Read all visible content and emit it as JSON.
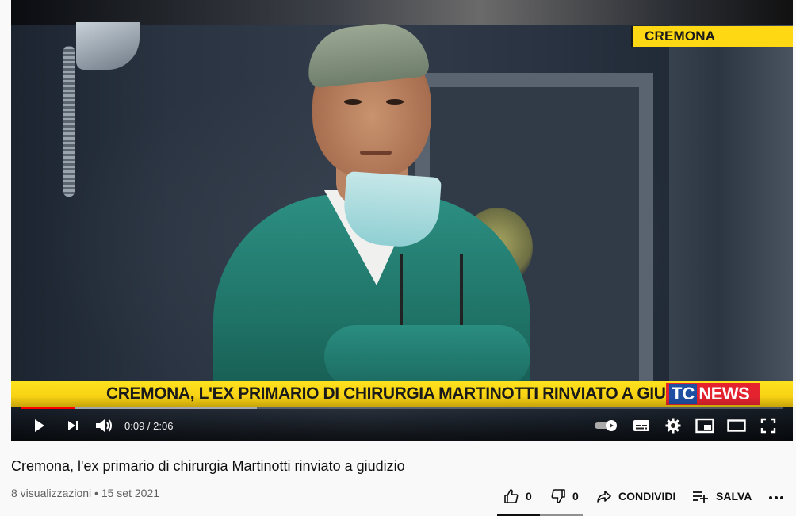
{
  "video": {
    "station_tag": "CREMONA",
    "lower_third": "CREMONA, L'EX PRIMARIO DI CHIRURGIA MARTINOTTI RINVIATO A GIUDIZIO",
    "logo_tc": "TC",
    "logo_news": "NEWS",
    "current_time": "0:09",
    "duration": "2:06",
    "time_display": "0:09 / 2:06",
    "played_fraction": 0.071,
    "buffered_fraction": 0.31
  },
  "controls": {
    "icons": [
      "play-icon",
      "next-icon",
      "volume-icon",
      "autoplay-toggle-icon",
      "subtitles-icon",
      "settings-icon",
      "miniplayer-icon",
      "theater-mode-icon",
      "fullscreen-icon"
    ]
  },
  "info": {
    "title": "Cremona, l'ex primario di chirurgia Martinotti rinviato a giudizio",
    "views": "8 visualizzazioni",
    "separator": "•",
    "date": "15 set 2021",
    "meta_line": "8 visualizzazioni • 15 set 2021"
  },
  "actions": {
    "like_count": "0",
    "dislike_count": "0",
    "share_label": "CONDIVIDI",
    "save_label": "SALVA",
    "more_icon": "more-horizontal-icon"
  },
  "colors": {
    "progress_played": "#ff0000",
    "banner_yellow": "#ffd814",
    "logo_red": "#e4232f",
    "logo_blue": "#1f4fa3"
  }
}
